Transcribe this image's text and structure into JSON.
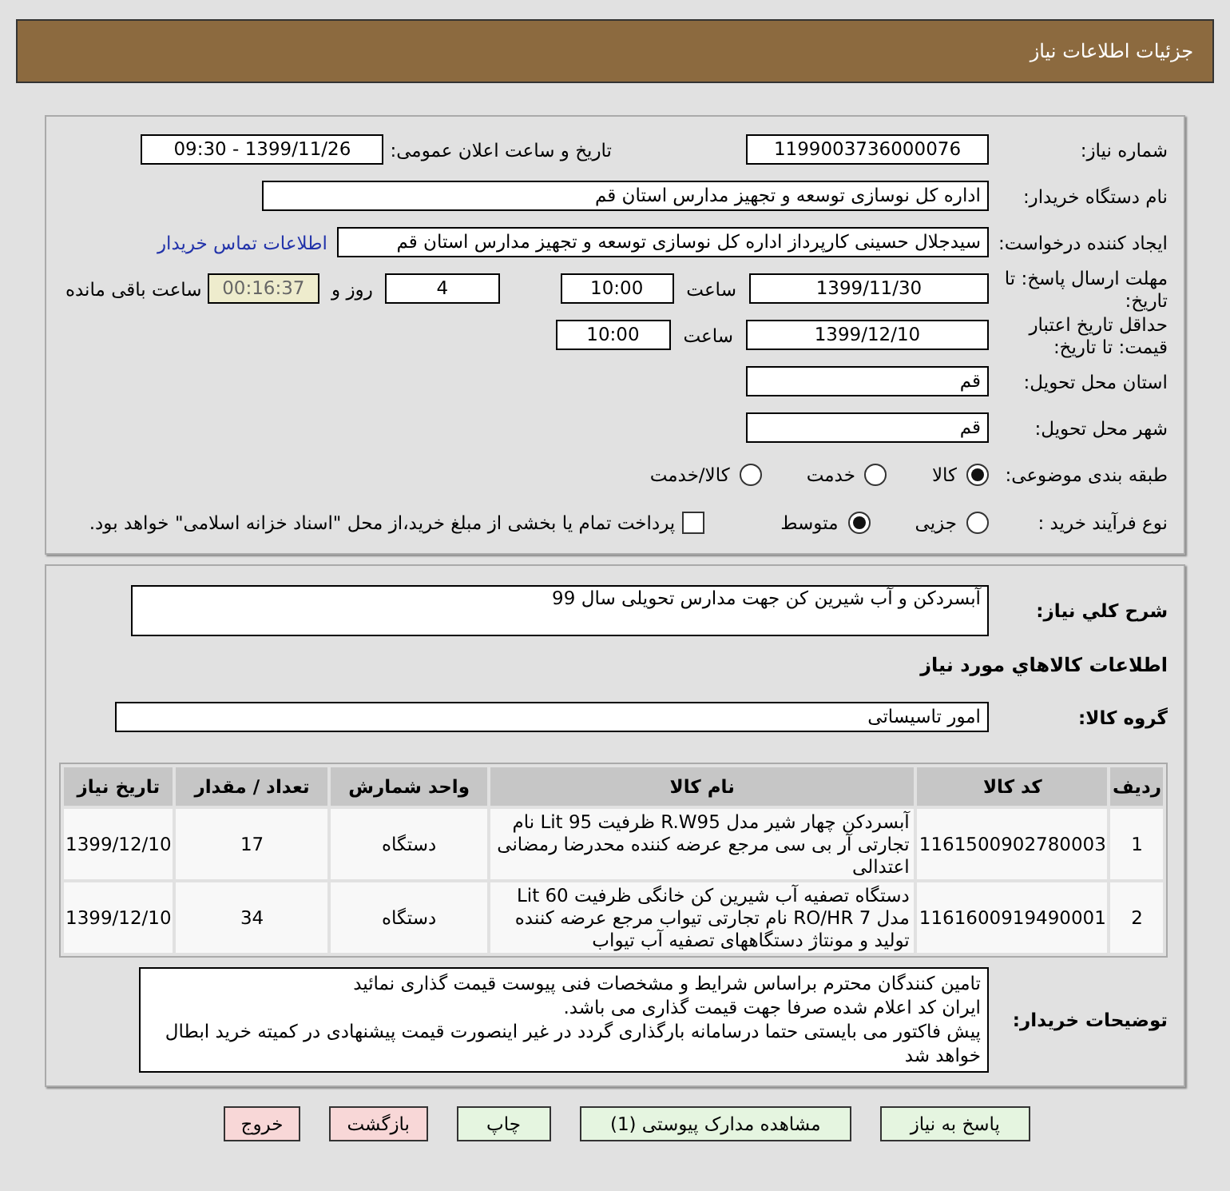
{
  "header": {
    "title": "جزئیات اطلاعات نیاز"
  },
  "need_number": {
    "label": "شماره نیاز:",
    "value": "1199003736000076"
  },
  "announce": {
    "label": "تاریخ و ساعت اعلان عمومی:",
    "value": "1399/11/26 - 09:30"
  },
  "buyer": {
    "label": "نام دستگاه خریدار:",
    "value": "اداره کل نوسازی توسعه و تجهیز مدارس استان قم"
  },
  "creator": {
    "label": "ایجاد کننده درخواست:",
    "value": "سیدجلال حسینی کارپرداز اداره کل نوسازی توسعه و تجهیز مدارس استان قم",
    "link": "اطلاعات تماس خریدار"
  },
  "deadline": {
    "label": "مهلت ارسال پاسخ: تا تاریخ:",
    "date": "1399/11/30",
    "time_label": "ساعت",
    "time": "10:00",
    "days": "4",
    "days_label": "روز و",
    "remaining": "00:16:37",
    "remaining_label": "ساعت باقی مانده"
  },
  "validity": {
    "label": "حداقل تاریخ اعتبار قیمت: تا تاریخ:",
    "date": "1399/12/10",
    "time_label": "ساعت",
    "time": "10:00"
  },
  "province": {
    "label": "استان محل تحویل:",
    "value": "قم"
  },
  "city": {
    "label": "شهر محل تحویل:",
    "value": "قم"
  },
  "category": {
    "label": "طبقه بندی موضوعی:",
    "options": [
      {
        "label": "کالا",
        "selected": true
      },
      {
        "label": "خدمت",
        "selected": false
      },
      {
        "label": "کالا/خدمت",
        "selected": false
      }
    ]
  },
  "process": {
    "label": "نوع فرآیند خرید :",
    "options": [
      {
        "label": "جزیی",
        "selected": false
      },
      {
        "label": "متوسط",
        "selected": true
      }
    ],
    "treasury": {
      "label": "پرداخت تمام یا بخشی از مبلغ خرید،از محل \"اسناد خزانه اسلامی\" خواهد بود.",
      "checked": false
    }
  },
  "description": {
    "label": "شرح کلي نياز:",
    "value": "آبسردکن و آب شیرین کن جهت مدارس تحویلی سال 99"
  },
  "goods_heading": "اطلاعات کالاهاي مورد نياز",
  "goods_group": {
    "label": "گروه کالا:",
    "value": "امور تاسیساتی"
  },
  "table": {
    "columns": [
      "ردیف",
      "کد کالا",
      "نام کالا",
      "واحد شمارش",
      "تعداد / مقدار",
      "تاریخ نیاز"
    ],
    "rows": [
      [
        "1",
        "1161500902780003",
        "آبسردکن چهار شیر مدل R.W95 ظرفیت Lit 95 نام تجارتی آر بی سی مرجع عرضه کننده محدرضا رمضانی اعتدالی",
        "دستگاه",
        "17",
        "1399/12/10"
      ],
      [
        "2",
        "1161600919490001",
        "دستگاه تصفیه آب شیرین کن خانگی ظرفیت Lit 60 مدل RO/HR 7 نام تجارتی تیواب مرجع عرضه کننده تولید و مونتاژ دستگاههای تصفیه آب تیواب",
        "دستگاه",
        "34",
        "1399/12/10"
      ]
    ]
  },
  "buyer_notes": {
    "label": "توضیحات خریدار:",
    "lines": [
      "تامین کنندگان محترم براساس شرایط و مشخصات فنی پیوست قیمت گذاری نمائید",
      "ایران کد اعلام شده صرفا جهت قیمت گذاری می باشد.",
      "پیش فاکتور می بایستی حتما درسامانه بارگذاری گردد در غیر اینصورت قیمت پیشنهادی در کمیته خرید ابطال خواهد شد"
    ]
  },
  "buttons": [
    {
      "label": "پاسخ به نیاز",
      "kind": "normal"
    },
    {
      "label": "مشاهده مدارک پیوستی (1)",
      "kind": "normal"
    },
    {
      "label": "چاپ",
      "kind": "normal"
    },
    {
      "label": "بازگشت",
      "kind": "exit"
    },
    {
      "label": "خروج",
      "kind": "exit"
    }
  ]
}
